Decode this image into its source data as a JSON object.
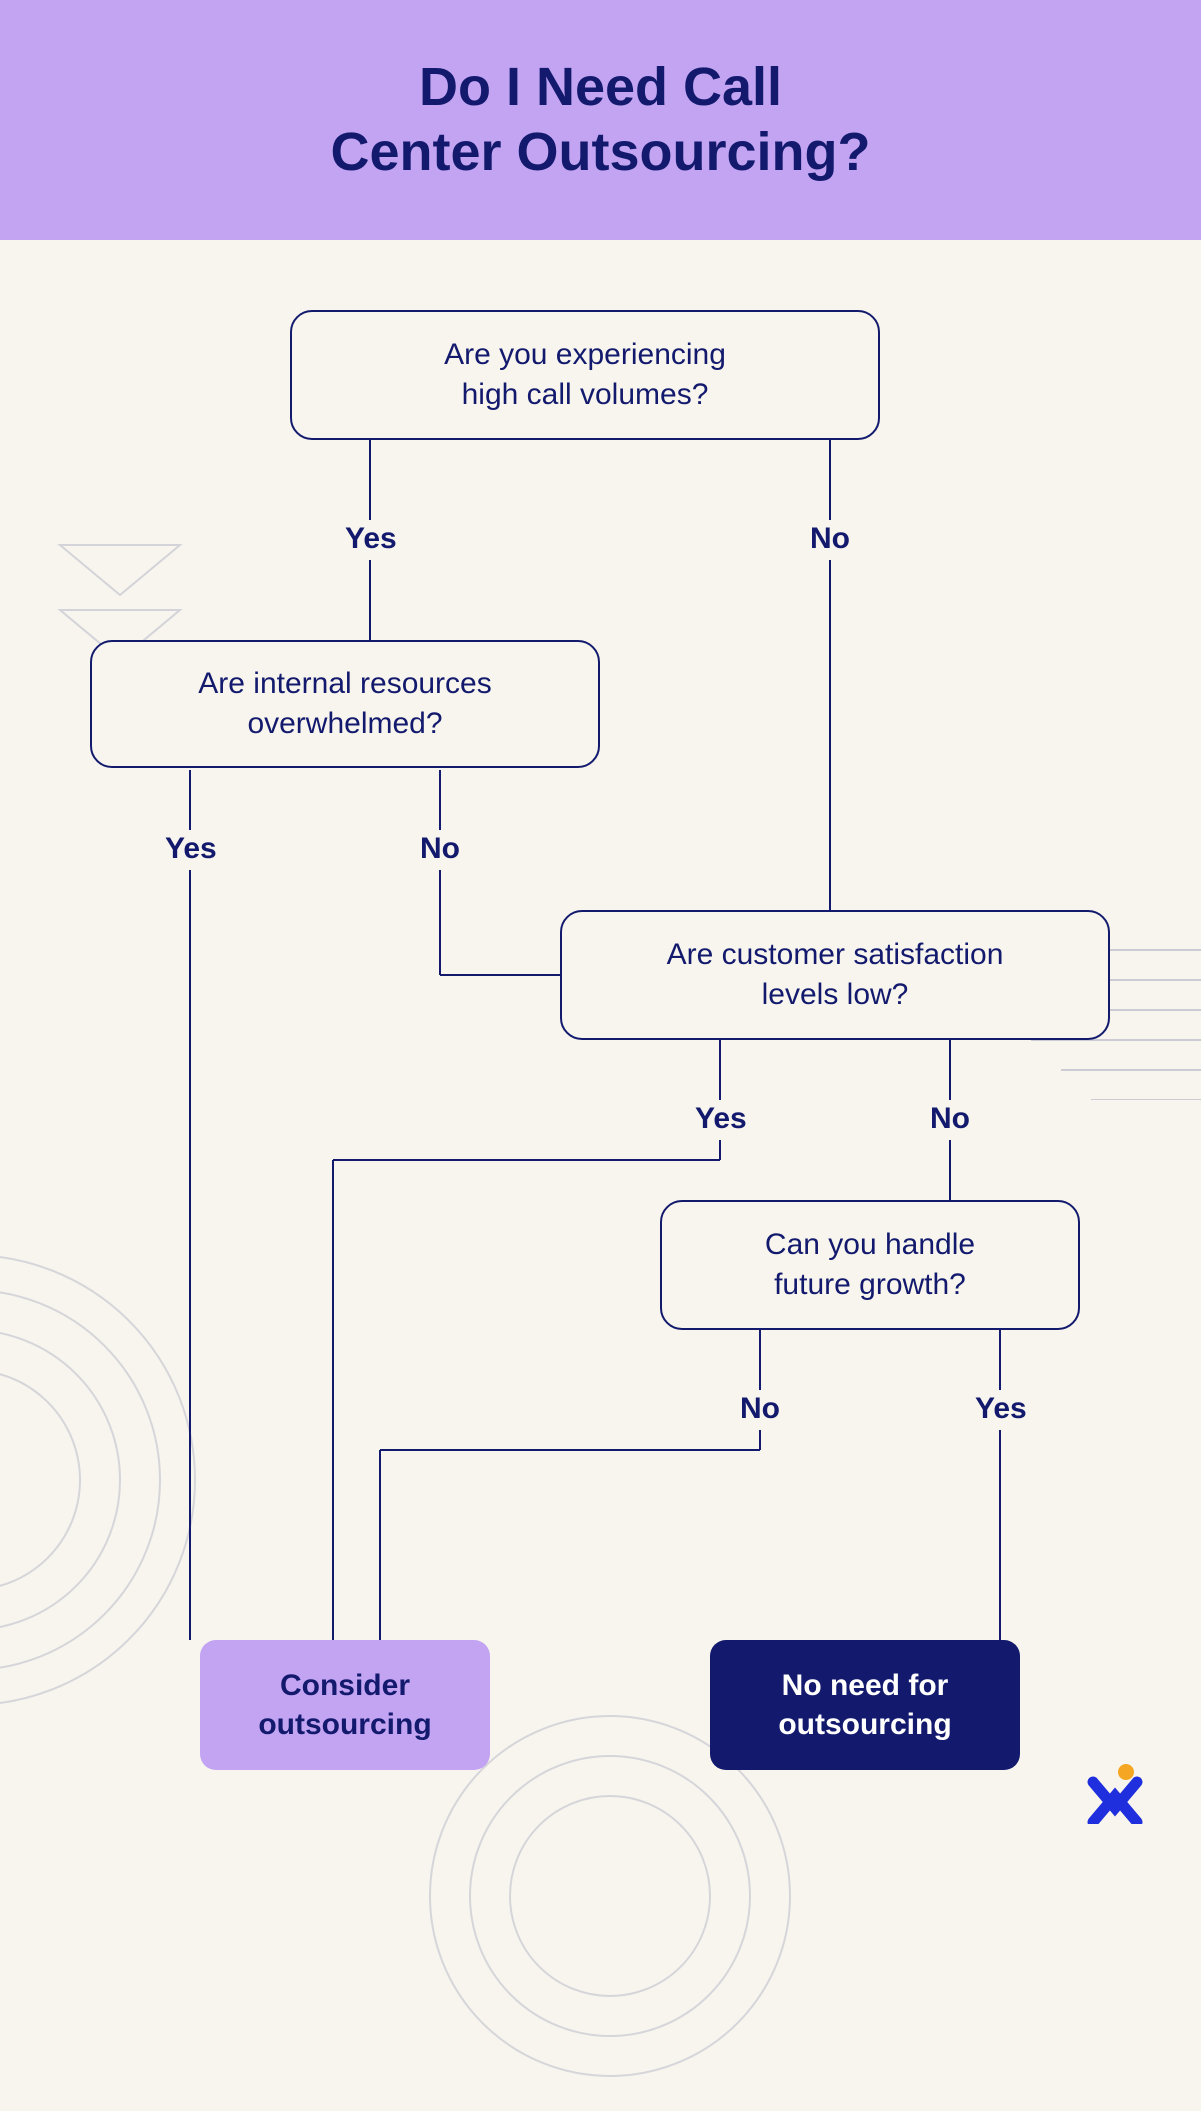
{
  "header": {
    "title_line1": "Do I Need Call",
    "title_line2": "Center Outsourcing?"
  },
  "nodes": {
    "q1": {
      "line1": "Are you experiencing",
      "line2": "high call volumes?"
    },
    "q2": {
      "line1": "Are internal resources",
      "line2": "overwhelmed?"
    },
    "q3": {
      "line1": "Are customer satisfaction",
      "line2": "levels low?"
    },
    "q4": {
      "line1": "Can you handle",
      "line2": "future growth?"
    }
  },
  "labels": {
    "yes": "Yes",
    "no": "No"
  },
  "results": {
    "consider": {
      "line1": "Consider",
      "line2": "outsourcing"
    },
    "noneed": {
      "line1": "No need for",
      "line2": "outsourcing"
    }
  },
  "colors": {
    "header_bg": "#c3a4f2",
    "page_bg": "#f7f5ed",
    "navy": "#131a6e",
    "accent_purple": "#c3a4f2",
    "logo_orange": "#f5a623",
    "logo_blue": "#1f2fdd"
  },
  "chart_data": {
    "type": "flowchart",
    "title": "Do I Need Call Center Outsourcing?",
    "nodes": [
      {
        "id": "q1",
        "kind": "decision",
        "text": "Are you experiencing high call volumes?"
      },
      {
        "id": "q2",
        "kind": "decision",
        "text": "Are internal resources overwhelmed?"
      },
      {
        "id": "q3",
        "kind": "decision",
        "text": "Are customer satisfaction levels low?"
      },
      {
        "id": "q4",
        "kind": "decision",
        "text": "Can you handle future growth?"
      },
      {
        "id": "r1",
        "kind": "result",
        "text": "Consider outsourcing",
        "style": "purple"
      },
      {
        "id": "r2",
        "kind": "result",
        "text": "No need for outsourcing",
        "style": "navy"
      }
    ],
    "edges": [
      {
        "from": "q1",
        "to": "q2",
        "label": "Yes"
      },
      {
        "from": "q1",
        "to": "q3",
        "label": "No"
      },
      {
        "from": "q2",
        "to": "r1",
        "label": "Yes"
      },
      {
        "from": "q2",
        "to": "q3",
        "label": "No"
      },
      {
        "from": "q3",
        "to": "r1",
        "label": "Yes"
      },
      {
        "from": "q3",
        "to": "q4",
        "label": "No"
      },
      {
        "from": "q4",
        "to": "r1",
        "label": "No"
      },
      {
        "from": "q4",
        "to": "r2",
        "label": "Yes"
      }
    ]
  }
}
